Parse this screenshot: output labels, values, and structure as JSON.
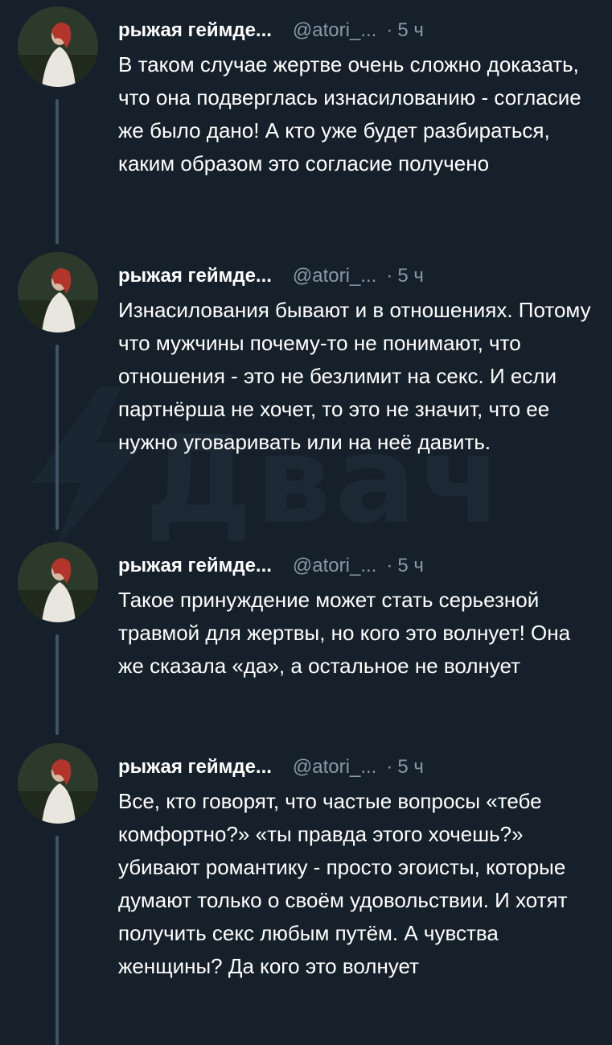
{
  "watermark": {
    "text": "Двач"
  },
  "tweets": [
    {
      "author": "рыжая геймде...",
      "handle": "@atori_...",
      "dot": "·",
      "time": "5 ч",
      "text": "В таком случае жертве очень сложно доказать, что она подверглась изнасилованию - согласие же было дано! А кто уже будет разбираться, каким образом это согласие получено"
    },
    {
      "author": "рыжая геймде...",
      "handle": "@atori_...",
      "dot": "·",
      "time": "5 ч",
      "text": "Изнасилования бывают и в отношениях. Потому что мужчины почему-то не понимают, что отношения - это не безлимит на секс. И если партнёрша не хочет, то это не значит, что ее нужно уговаривать или на неё давить."
    },
    {
      "author": "рыжая геймде...",
      "handle": "@atori_...",
      "dot": "·",
      "time": "5 ч",
      "text": "Такое принуждение может стать серьезной травмой для жертвы, но кого это волнует! Она же сказала «да», а остальное не волнует"
    },
    {
      "author": "рыжая геймде...",
      "handle": "@atori_...",
      "dot": "·",
      "time": "5 ч",
      "text": "Все, кто говорят, что частые вопросы «тебе комфортно?» «ты правда этого хочешь?» убивают романтику - просто эгоисты, которые думают только о своём удовольствии. И хотят получить секс любым путём. А чувства женщины? Да кого это волнует"
    }
  ]
}
